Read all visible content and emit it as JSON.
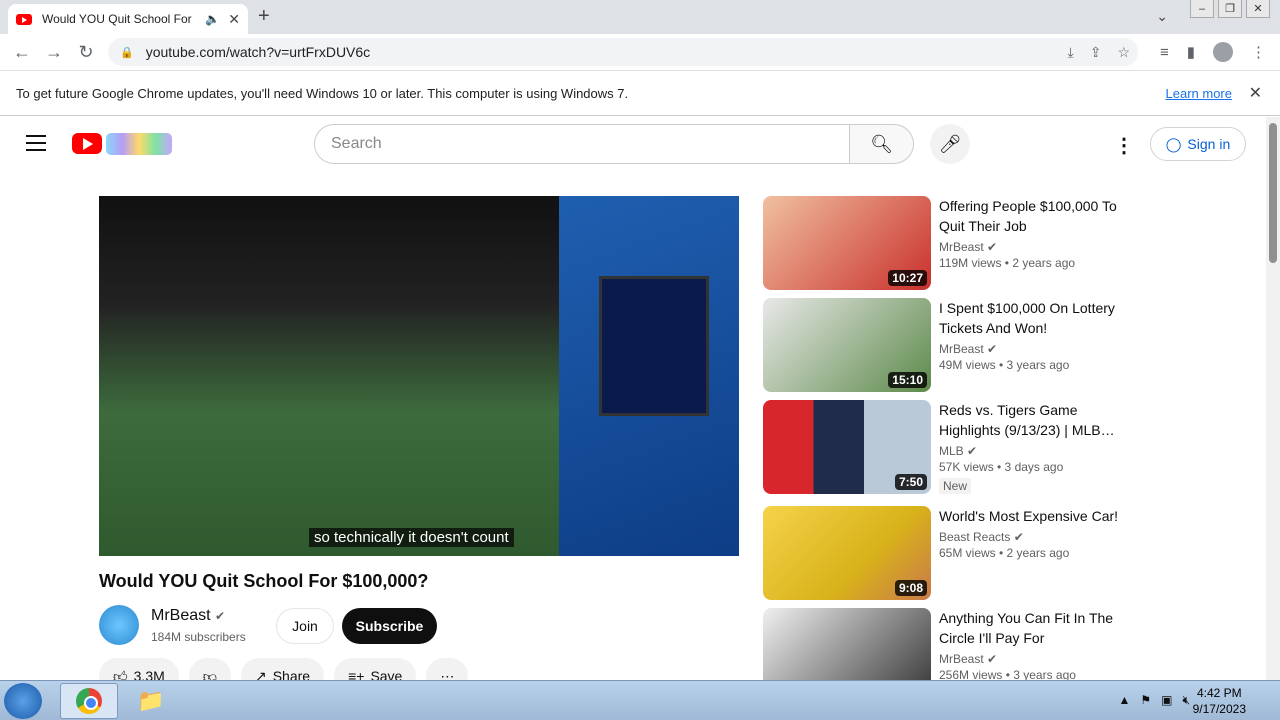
{
  "browser": {
    "tab_title": "Would YOU Quit School For",
    "url": "youtube.com/watch?v=urtFrxDUV6c",
    "infobar_text": "To get future Google Chrome updates, you'll need Windows 10 or later. This computer is using Windows 7.",
    "learn_more": "Learn more"
  },
  "youtube": {
    "search_placeholder": "Search",
    "sign_in": "Sign in",
    "video": {
      "caption": "so technically it doesn't count",
      "title": "Would YOU Quit School For $100,000?",
      "channel": "MrBeast",
      "subscribers": "184M subscribers",
      "join": "Join",
      "subscribe": "Subscribe",
      "likes": "3.3M",
      "share": "Share",
      "save": "Save"
    },
    "recommendations": [
      {
        "title": "Offering People $100,000 To Quit Their Job",
        "channel": "MrBeast",
        "meta": "119M views • 2 years ago",
        "duration": "10:27",
        "color": "#c9302c"
      },
      {
        "title": "I Spent $100,000 On Lottery Tickets And Won!",
        "channel": "MrBeast",
        "meta": "49M views • 3 years ago",
        "duration": "15:10",
        "color": "#5d8a4a"
      },
      {
        "title": "Reds vs. Tigers Game Highlights (9/13/23) | MLB…",
        "channel": "MLB",
        "meta": "57K views • 3 days ago",
        "duration": "7:50",
        "badge": "New",
        "color": "#1f2d4a"
      },
      {
        "title": "World's Most Expensive Car!",
        "channel": "Beast Reacts",
        "meta": "65M views • 2 years ago",
        "duration": "9:08",
        "color": "#d8b21a"
      },
      {
        "title": "Anything You Can Fit In The Circle I'll Pay For",
        "channel": "MrBeast",
        "meta": "256M views • 3 years ago",
        "duration": "",
        "color": "#333333"
      }
    ]
  },
  "taskbar": {
    "time": "4:42 PM",
    "date": "9/17/2023"
  }
}
